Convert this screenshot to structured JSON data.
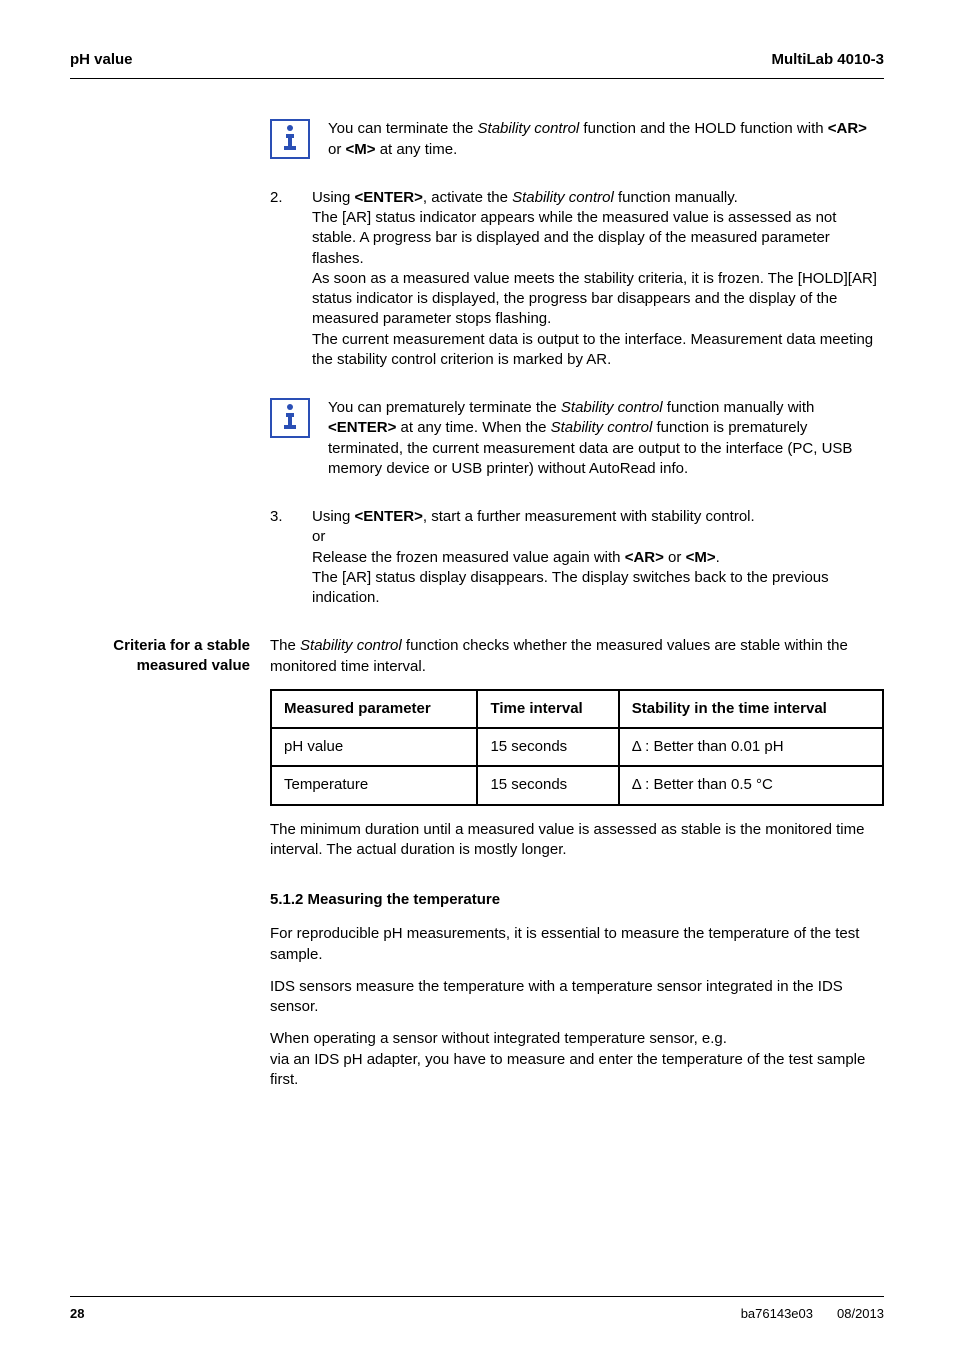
{
  "header": {
    "left": "pH value",
    "right": "MultiLab 4010-3"
  },
  "info1": "You can terminate the Stability control function and the HOLD function with <AR> or <M> at any time.",
  "step2": {
    "num": "2.",
    "text": "Using <ENTER>, activate the Stability control function manually.\nThe [AR] status indicator appears while the measured value is assessed as not stable. A progress bar is displayed and the display of the measured parameter flashes.\nAs soon as a measured value meets the stability criteria, it is frozen. The [HOLD][AR] status indicator is displayed, the progress bar disappears and the display of the measured parameter stops flashing.\nThe current measurement data is output to the interface. Measurement data meeting the stability control criterion is marked by AR."
  },
  "info2": "You can prematurely terminate the Stability control function manually with <ENTER> at any time. When the Stability control function is prematurely terminated, the current measurement data are output to the interface (PC, USB memory device or USB printer) without AutoRead info.",
  "step3": {
    "num": "3.",
    "text": "Using <ENTER>, start a further measurement with stability control.\nor\nRelease the frozen measured value again with <AR> or <M>.\nThe [AR] status display disappears. The display switches back to the previous indication."
  },
  "criteria": {
    "label": "Criteria for a stable measured value",
    "intro": "The Stability control function checks whether the measured values are stable within the monitored time interval.",
    "table": {
      "headers": [
        "Measured parameter",
        "Time interval",
        "Stability in the time interval"
      ],
      "rows": [
        [
          "pH value",
          "15 seconds",
          "Δ : Better than 0.01 pH"
        ],
        [
          "Temperature",
          "15 seconds",
          "Δ : Better than 0.5 °C"
        ]
      ]
    },
    "outro": "The minimum duration until a measured value is assessed as stable is the monitored time interval. The actual duration is mostly longer."
  },
  "section": {
    "heading": "5.1.2   Measuring the temperature",
    "p1": "For reproducible pH measurements, it is essential to measure the temperature of the test sample.",
    "p2": "IDS sensors measure the temperature with a temperature sensor integrated in the IDS sensor.",
    "p3": "When operating a sensor without integrated temperature sensor, e.g.\nvia an IDS pH adapter, you have to measure and enter the temperature of the test sample first."
  },
  "footer": {
    "page": "28",
    "doc": "ba76143e03",
    "date": "08/2013"
  }
}
